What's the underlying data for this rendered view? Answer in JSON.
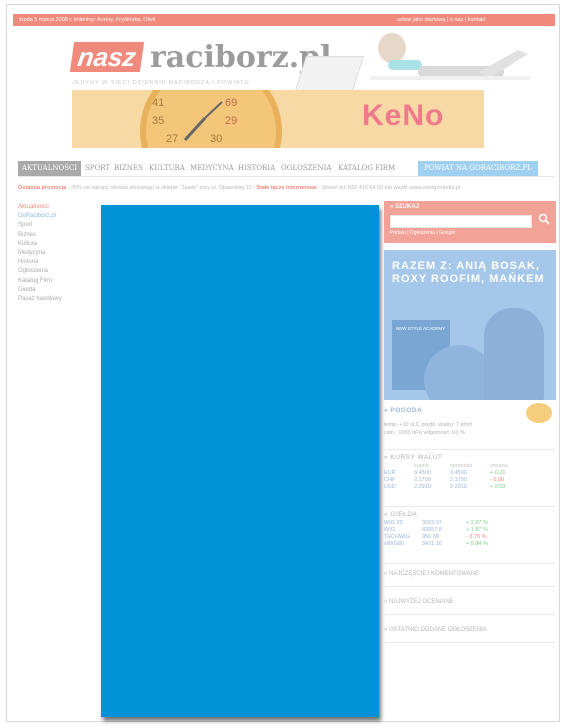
{
  "topbar": {
    "left": "środa 5 marca 2008 r. imieniny: Aurory, Fryderyka, Olivii",
    "right": "ustaw jako startową | o nas | kontakt"
  },
  "brand": {
    "logo_box": "nasz",
    "logo_text": "raciborz.pl",
    "tagline": "JEDYNY W SIECI DZIENNIK RACIBORZA I POWIATU"
  },
  "banner": {
    "keno": "KeNo",
    "clock_numbers": [
      "41",
      "69",
      "35",
      "29",
      "27",
      "30"
    ]
  },
  "nav": {
    "items": [
      "AKTUALNOŚCI",
      "SPORT",
      "BIZNES",
      "KULTURA",
      "MEDYCYNA",
      "HISTORIA",
      "OGŁOSZENIA",
      "KATALOG FIRM"
    ],
    "powiat": "POWIAT NA GORACIBORZ.PL"
  },
  "promo": {
    "label": "Ostatnia promocja",
    "text": " - 30% na zakupy obuwia zimowego w sklepie \"Jasek\" przy ul. Opawskiej 12 | ",
    "label2": "Stałe łącze internetowe",
    "text2": " - dzwoń tel. 032 415 64 03 lub wejdź www.energomedia.pl"
  },
  "left_nav": {
    "items": [
      "Aktualności",
      "GoRaciborz.pl",
      "Sport",
      "Biznes",
      "Kultura",
      "Medycyna",
      "Historia",
      "Ogłoszenia",
      "Katalog Firm",
      "Giełda",
      "Pasaż handlowy"
    ]
  },
  "search": {
    "title": "» SZUKAJ",
    "tabs": "Portalu | Ogłoszenia | Google"
  },
  "promo_box": {
    "title": "RAZEM Z: ANIĄ BOSAK, ROXY ROOFIM, MAŃKEM",
    "cd_label": "NEW STYLE ACADEMY"
  },
  "weather": {
    "title": "» POGODA",
    "line1": "temp. +10 st.C     prędk. wiatru: 7 km/h",
    "line2": "ciśn.: 1003 hPa     wilgotność: 63 %"
  },
  "currency": {
    "title": "» KURSY WALUT",
    "headers": [
      "",
      "kupno",
      "sprzedaż",
      "zmiana"
    ],
    "rows": [
      [
        "EUR",
        "3.4500",
        "3.4500",
        "+ 0.21"
      ],
      [
        "CHF",
        "2.1709",
        "2.1709",
        "- 0.00"
      ],
      [
        "USD",
        "2.2910",
        "2.2010",
        "+ 0.03"
      ]
    ]
  },
  "exchange": {
    "title": "» GIEŁDA",
    "rows": [
      [
        "WIG 20",
        "3023.37",
        "+ 2.07 %"
      ],
      [
        "WIG",
        "43557.8",
        "+ 1.87 %"
      ],
      [
        "TECHWIG",
        "956.69",
        "- 3.75 %"
      ],
      [
        "sWIG80",
        "3421.16",
        "+ 0.84 %"
      ]
    ]
  },
  "links": {
    "most_commented": "» NAJCZĘŚCIEJ KOMENTOWANE",
    "top_rated": "» NAJWYŻEJ OCENIANE",
    "recent_ads": "» OSTATNIO DODANE OGŁOSZENIA"
  },
  "colors": {
    "accent": "#f08a7c",
    "blue_panel": "#0292d7",
    "nav_powiat": "#9fd0ef"
  }
}
